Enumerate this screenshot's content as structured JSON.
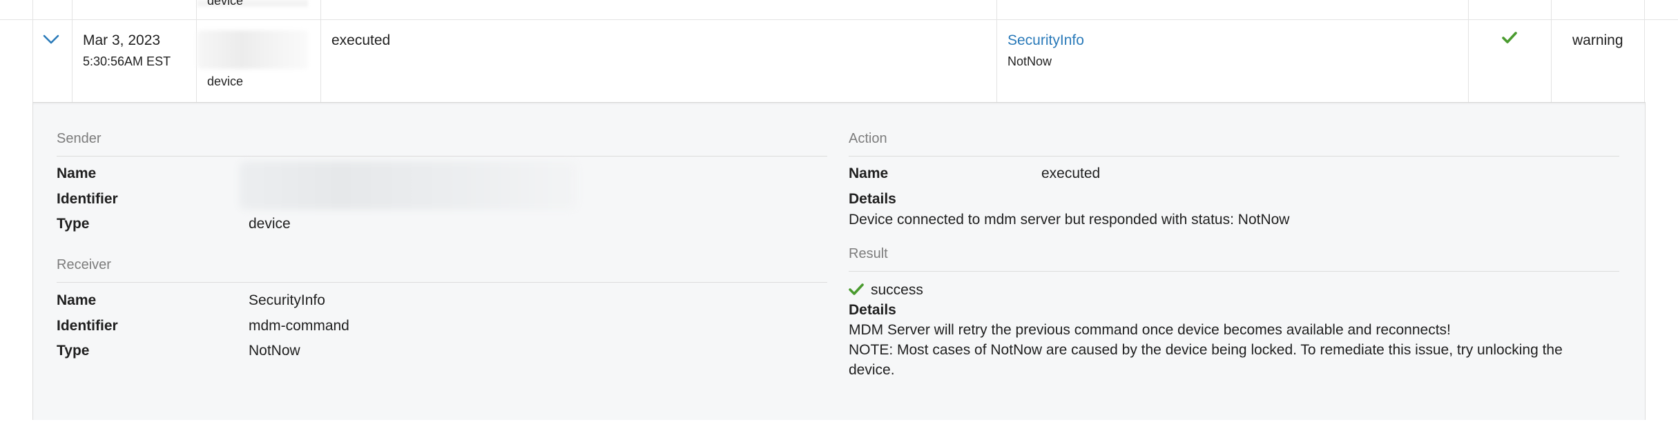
{
  "top_row": {
    "type_label": "device"
  },
  "row": {
    "date": "Mar 3, 2023",
    "time": "5:30:56AM EST",
    "sender_type": "device",
    "action": "executed",
    "receiver_name": "SecurityInfo",
    "receiver_sub": "NotNow",
    "level": "warning"
  },
  "details": {
    "sender": {
      "title": "Sender",
      "name_label": "Name",
      "identifier_label": "Identifier",
      "type_label": "Type",
      "type_value": "device"
    },
    "receiver": {
      "title": "Receiver",
      "name_label": "Name",
      "name_value": "SecurityInfo",
      "identifier_label": "Identifier",
      "identifier_value": "mdm-command",
      "type_label": "Type",
      "type_value": "NotNow"
    },
    "action": {
      "title": "Action",
      "name_label": "Name",
      "name_value": "executed",
      "details_label": "Details",
      "details_text": "Device connected to mdm server but responded with status: NotNow"
    },
    "result": {
      "title": "Result",
      "status": "success",
      "details_label": "Details",
      "line1": "MDM Server will retry the previous command once device becomes available and reconnects!",
      "line2": "NOTE: Most cases of NotNow are caused by the device being locked. To remediate this issue, try unlocking the",
      "line3": "device."
    }
  },
  "icons": {
    "expand": "chevron-down-icon",
    "check": "checkmark-icon"
  },
  "colors": {
    "link": "#2a7ab9",
    "check": "#4a9b2f",
    "chevron": "#2a7ab9"
  }
}
